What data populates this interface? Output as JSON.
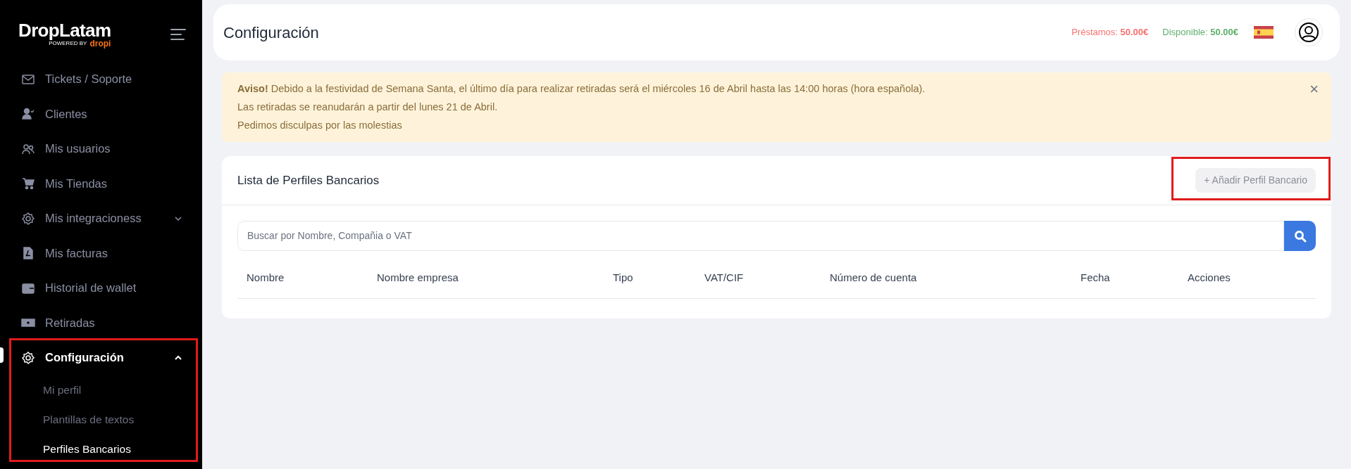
{
  "sidebar": {
    "logo": {
      "brand": "DropLatam",
      "tagline": "POWERED BY",
      "sub_brand": "dropi"
    },
    "items": [
      {
        "label": "Tickets / Soporte"
      },
      {
        "label": "Clientes"
      },
      {
        "label": "Mis usuarios"
      },
      {
        "label": "Mis Tiendas"
      },
      {
        "label": "Mis integracioness",
        "expanded": false
      },
      {
        "label": "Mis facturas"
      },
      {
        "label": "Historial de wallet"
      },
      {
        "label": "Retiradas"
      },
      {
        "label": "Configuración",
        "expanded": true,
        "children": [
          {
            "label": "Mi perfil",
            "selected": false
          },
          {
            "label": "Plantillas de textos",
            "selected": false
          },
          {
            "label": "Perfiles Bancarios",
            "selected": true
          }
        ]
      }
    ]
  },
  "header": {
    "title": "Configuración",
    "loans_label": "Préstamos:",
    "loans_value": "50.00€",
    "available_label": "Disponible:",
    "available_value": "50.00€"
  },
  "alert": {
    "lines": [
      "**Aviso!** Debido a la festividad de Semana Santa, el último día para realizar retiradas será el miércoles 16 de Abril hasta las 14:00 horas (hora española).",
      "Las retiradas se reanudarán a partir del lunes 21 de Abril.",
      "Pedimos disculpas por las molestias"
    ],
    "close": "×"
  },
  "card": {
    "title": "Lista de Perfiles Bancarios",
    "add_button": "+ Añadir Perfil Bancario",
    "search": {
      "placeholder": "Buscar por Nombre, Compañia o VAT"
    },
    "table": {
      "columns": [
        "Nombre",
        "Nombre empresa",
        "Tipo",
        "VAT/CIF",
        "Número de cuenta",
        "Fecha",
        "Acciones"
      ]
    }
  }
}
